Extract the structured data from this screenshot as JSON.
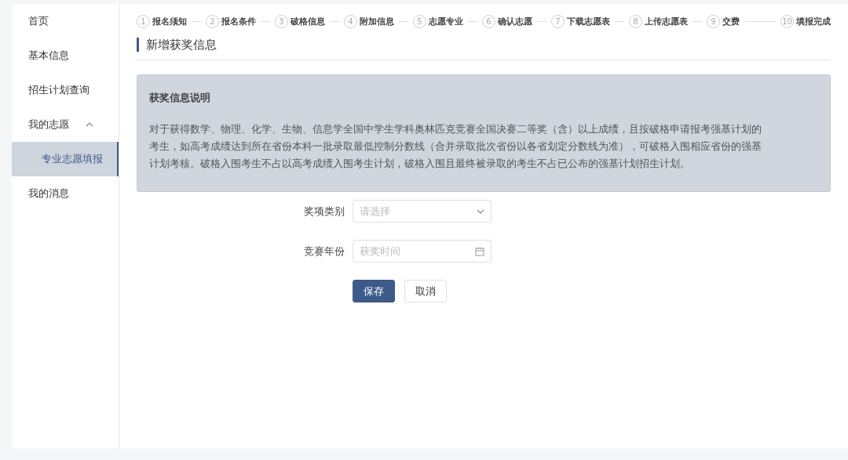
{
  "sidebar": {
    "items": [
      {
        "label": "首页",
        "selected": false
      },
      {
        "label": "基本信息",
        "selected": false
      },
      {
        "label": "招生计划查询",
        "selected": false
      },
      {
        "label": "我的志愿",
        "expanded": true,
        "selected": false,
        "children": [
          {
            "label": "专业志愿填报",
            "selected": true
          }
        ]
      },
      {
        "label": "我的消息",
        "selected": false
      }
    ]
  },
  "steps": [
    {
      "number": "1",
      "label": "报名须知"
    },
    {
      "number": "2",
      "label": "报名条件"
    },
    {
      "number": "3",
      "label": "破格信息"
    },
    {
      "number": "4",
      "label": "附加信息"
    },
    {
      "number": "5",
      "label": "志愿专业"
    },
    {
      "number": "6",
      "label": "确认志愿"
    },
    {
      "number": "7",
      "label": "下载志愿表"
    },
    {
      "number": "8",
      "label": "上传志愿表"
    },
    {
      "number": "9",
      "label": "交费"
    },
    {
      "number": "10",
      "label": "填报完成"
    }
  ],
  "page_title": "新增获奖信息",
  "notice": {
    "title": "获奖信息说明",
    "body": "对于获得数学、物理、化学、生物、信息学全国中学生学科奥林匹克竞赛全国决赛二等奖（含）以上成绩，且按破格申请报考强基计划的考生，如高考成绩达到所在省份本科一批录取最低控制分数线（合并录取批次省份以各省划定分数线为准），可破格入围相应省份的强基计划考核。破格入围考生不占以高考成绩入围考生计划，破格入围且最终被录取的考生不占已公布的强基计划招生计划。"
  },
  "form": {
    "fields": [
      {
        "kind": "select",
        "label": "奖项类别",
        "placeholder": "请选择"
      },
      {
        "kind": "date",
        "label": "竞赛年份",
        "placeholder": "获奖时间"
      }
    ]
  },
  "buttons": [
    {
      "label": "保存",
      "primary": true
    },
    {
      "label": "取消",
      "primary": false
    }
  ]
}
